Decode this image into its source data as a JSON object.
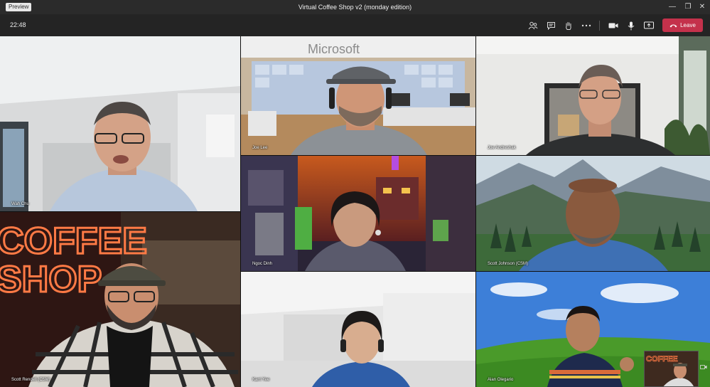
{
  "window": {
    "badge": "Preview",
    "title": "Virtual Coffee Shop v2 (monday edition)",
    "minimize_glyph": "—",
    "maximize_glyph": "❐",
    "close_glyph": "✕"
  },
  "call": {
    "timer": "22:48",
    "leave_label": "Leave",
    "icons": [
      "people-icon",
      "chat-icon",
      "raise-hand-icon",
      "more-icon",
      "camera-icon",
      "microphone-icon",
      "share-screen-icon",
      "phone-hangup-icon"
    ],
    "leave_color": "#c4314b"
  },
  "participants": [
    {
      "name": "Wah Chu",
      "scene": "bright-apartment"
    },
    {
      "name": "Joe Lee",
      "scene": "microsoft-store"
    },
    {
      "name": "Joe Andreshak",
      "scene": "white-room-mirror"
    },
    {
      "name": "Ngoc Dinh",
      "scene": "minecraft-dungeon"
    },
    {
      "name": "Scott Johnson (CSM)",
      "scene": "mountain-valley"
    },
    {
      "name": "Scott Rendell (CSM)",
      "scene": "coffee-shop-neon"
    },
    {
      "name": "Karri Yee",
      "scene": "white-interior"
    },
    {
      "name": "Alan Olegario",
      "scene": "bliss-hill"
    }
  ],
  "neon_sign": {
    "line1": "COFFEE",
    "line2": "SHOP"
  }
}
